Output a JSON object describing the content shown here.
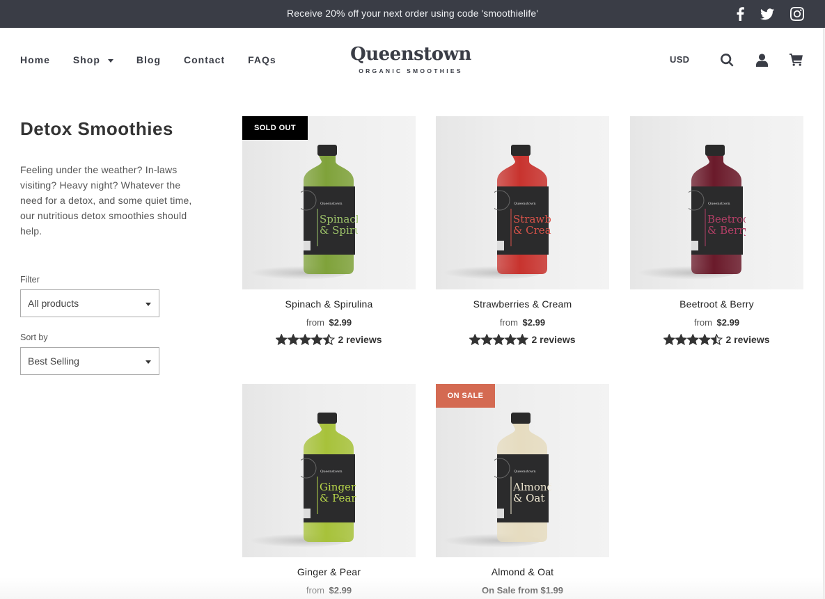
{
  "announcement": {
    "text": "Receive 20% off your next order using code 'smoothielife'",
    "social": [
      "facebook-icon",
      "twitter-icon",
      "instagram-icon"
    ]
  },
  "nav": {
    "items": [
      {
        "label": "Home",
        "has_dropdown": false
      },
      {
        "label": "Shop",
        "has_dropdown": true
      },
      {
        "label": "Blog",
        "has_dropdown": false
      },
      {
        "label": "Contact",
        "has_dropdown": false
      },
      {
        "label": "FAQs",
        "has_dropdown": false
      }
    ]
  },
  "logo": {
    "name": "Queenstown",
    "tagline": "ORGANIC SMOOTHIES"
  },
  "header_right": {
    "currency": "USD",
    "icons": [
      "search-icon",
      "account-icon",
      "cart-icon"
    ]
  },
  "sidebar": {
    "title": "Detox Smoothies",
    "description": "Feeling under the weather? In-laws visiting? Heavy night? Whatever the need for a detox, and some quiet time, our nutritious detox smoothies should help.",
    "filter_label": "Filter",
    "filter_value": "All products",
    "sort_label": "Sort by",
    "sort_value": "Best Selling"
  },
  "colors": {
    "announcement_bg": "#3a3d46",
    "text_dark": "#3a3d46",
    "sold_out_badge": "#000000",
    "on_sale_badge": "#d46a52"
  },
  "products": [
    {
      "name": "Spinach & Spirulina",
      "price_prefix": "from",
      "price": "$2.99",
      "rating": 4.5,
      "reviews": "2 reviews",
      "badge": "SOLD OUT",
      "badge_color": "#000000",
      "liquid_color": "#7fa23a",
      "label_text_color": "#9ec46a",
      "label_line1": "Spinach",
      "label_line2": "& Spirulina"
    },
    {
      "name": "Strawberries & Cream",
      "price_prefix": "from",
      "price": "$2.99",
      "rating": 5,
      "reviews": "2 reviews",
      "badge": null,
      "liquid_color": "#c8332e",
      "label_text_color": "#d9534a",
      "label_line1": "Strawberries",
      "label_line2": "& Cream"
    },
    {
      "name": "Beetroot & Berry",
      "price_prefix": "from",
      "price": "$2.99",
      "rating": 4.5,
      "reviews": "2 reviews",
      "badge": null,
      "liquid_color": "#6a1a2a",
      "label_text_color": "#b23f66",
      "label_line1": "Beetroot",
      "label_line2": "& Berry"
    },
    {
      "name": "Ginger & Pear",
      "price_prefix": "from",
      "price": "$2.99",
      "rating": null,
      "reviews": null,
      "badge": null,
      "liquid_color": "#a7c23a",
      "label_text_color": "#b6d44a",
      "label_line1": "Ginger",
      "label_line2": "& Pear"
    },
    {
      "name": "Almond & Oat",
      "price_prefix": null,
      "price": "On Sale from $1.99",
      "rating": null,
      "reviews": null,
      "badge": "ON SALE",
      "badge_color": "#d46a52",
      "liquid_color": "#e6dcc0",
      "label_text_color": "#f0e8d2",
      "label_line1": "Almond",
      "label_line2": "& Oat"
    }
  ]
}
